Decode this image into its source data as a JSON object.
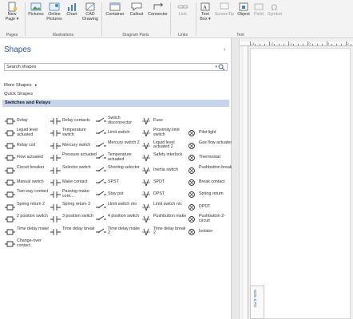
{
  "ribbon": {
    "groups": [
      {
        "label": "Pages",
        "buttons": [
          {
            "label": "New",
            "label2": "Page ▾",
            "icon": "new-page-icon"
          }
        ]
      },
      {
        "label": "Illustrations",
        "buttons": [
          {
            "label": "Pictures",
            "label2": "",
            "icon": "pictures-icon"
          },
          {
            "label": "Online",
            "label2": "Pictures",
            "icon": "online-pictures-icon"
          },
          {
            "label": "Chart",
            "label2": "",
            "icon": "chart-icon"
          },
          {
            "label": "CAD",
            "label2": "Drawing",
            "icon": "cad-drawing-icon"
          }
        ]
      },
      {
        "label": "Diagram Parts",
        "buttons": [
          {
            "label": "Container",
            "label2": "",
            "icon": "container-icon"
          },
          {
            "label": "Callout",
            "label2": "",
            "icon": "callout-icon"
          },
          {
            "label": "Connector",
            "label2": "",
            "icon": "connector-icon"
          }
        ]
      },
      {
        "label": "Links",
        "buttons": [
          {
            "label": "Link",
            "label2": "",
            "icon": "link-icon",
            "disabled": true
          }
        ]
      },
      {
        "label": "Text",
        "buttons": [
          {
            "label": "Text",
            "label2": "Box ▾",
            "icon": "text-box-icon"
          },
          {
            "label": "ScreenTip",
            "label2": "",
            "icon": "screentip-icon",
            "disabled": true
          },
          {
            "label": "Object",
            "label2": "",
            "icon": "object-icon"
          },
          {
            "label": "Field",
            "label2": "",
            "icon": "field-icon",
            "disabled": true
          },
          {
            "label": "Symbol",
            "label2": "",
            "icon": "symbol-icon",
            "disabled": true
          }
        ]
      }
    ]
  },
  "pane": {
    "title": "Shapes",
    "collapse_glyph": "‹",
    "search_placeholder": "Search shapes",
    "search_dropdown": "▾",
    "more_shapes": "More Shapes",
    "more_arrow": "▸",
    "quick_shapes": "Quick Shapes",
    "stencil": "Switches and Relays",
    "shapes": [
      [
        "Relay",
        "Relay contacts",
        "Switch disconnector",
        "Fuse",
        ""
      ],
      [
        "Liquid level actuated",
        "Temperature switch",
        "Limit switch",
        "Proximity limit switch",
        "Pilot light"
      ],
      [
        "Relay coil",
        "Mercury switch",
        "Mercury switch 2",
        "Liquid level actuated 2",
        "Gas flow actuated"
      ],
      [
        "Flow actuated",
        "Pressure actuated",
        "Temperature actuated",
        "Safety interlock",
        "Thermostat"
      ],
      [
        "Circuit breaker",
        "Selector switch",
        "Shorting selector",
        "Inertia switch",
        "Pushbutton break"
      ],
      [
        "Manual switch",
        "Make contact",
        "SPST",
        "SPDT",
        "Break contact"
      ],
      [
        "Two way contact",
        "Passing make-cont...",
        "Stay put",
        "DPST",
        "Spring return"
      ],
      [
        "Spring return 2",
        "Spring return 3",
        "Limit switch n/o",
        "Limit switch n/c",
        "DPDT"
      ],
      [
        "2 position switch",
        "3 position switch",
        "4 position switch",
        "Pushbutton make",
        "Pushbutton 2-circuit"
      ],
      [
        "Time delay make",
        "Time delay break",
        "Time delay make 2",
        "Time delay break 2",
        "Isolator"
      ],
      [
        "Change-over contact",
        "",
        "",
        "",
        ""
      ]
    ]
  },
  "canvas": {
    "ruler_labels": [
      "-3",
      "-2",
      "-1",
      "0",
      "1",
      "2"
    ],
    "page_tab": "SIZE & PO"
  }
}
